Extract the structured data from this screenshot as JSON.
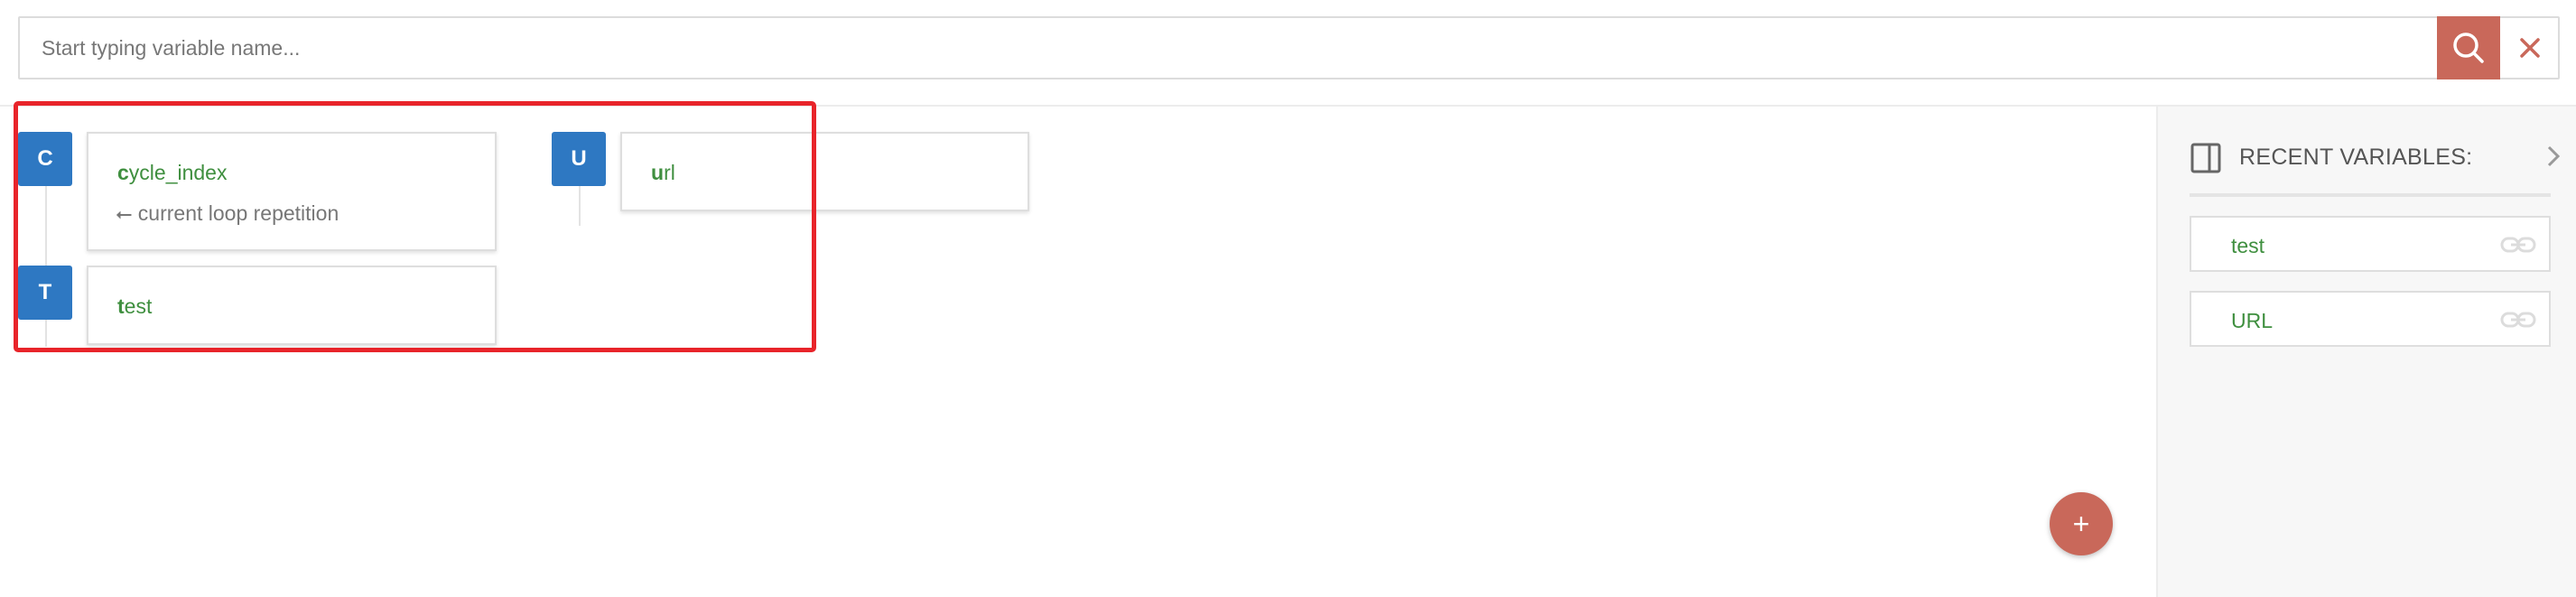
{
  "search": {
    "placeholder": "Start typing variable name...",
    "value": ""
  },
  "variables": [
    {
      "badge": "C",
      "first": "c",
      "rest": "ycle_index",
      "description": "⭠ current loop repetition"
    },
    {
      "badge": "U",
      "first": "u",
      "rest": "rl",
      "description": ""
    },
    {
      "badge": "T",
      "first": "t",
      "rest": "est",
      "description": ""
    }
  ],
  "panel": {
    "title": "RECENT VARIABLES:",
    "items": [
      {
        "label": "test"
      },
      {
        "label": "URL"
      }
    ]
  },
  "fab": {
    "label": "+"
  },
  "colors": {
    "accent": "#c9685a",
    "badge": "#2e78c2",
    "variable_text": "#3f8f3f",
    "highlight": "#e8242a"
  },
  "icons": [
    "search-icon",
    "close-icon",
    "panel-layout-icon",
    "chevron-right-icon",
    "link-icon"
  ]
}
